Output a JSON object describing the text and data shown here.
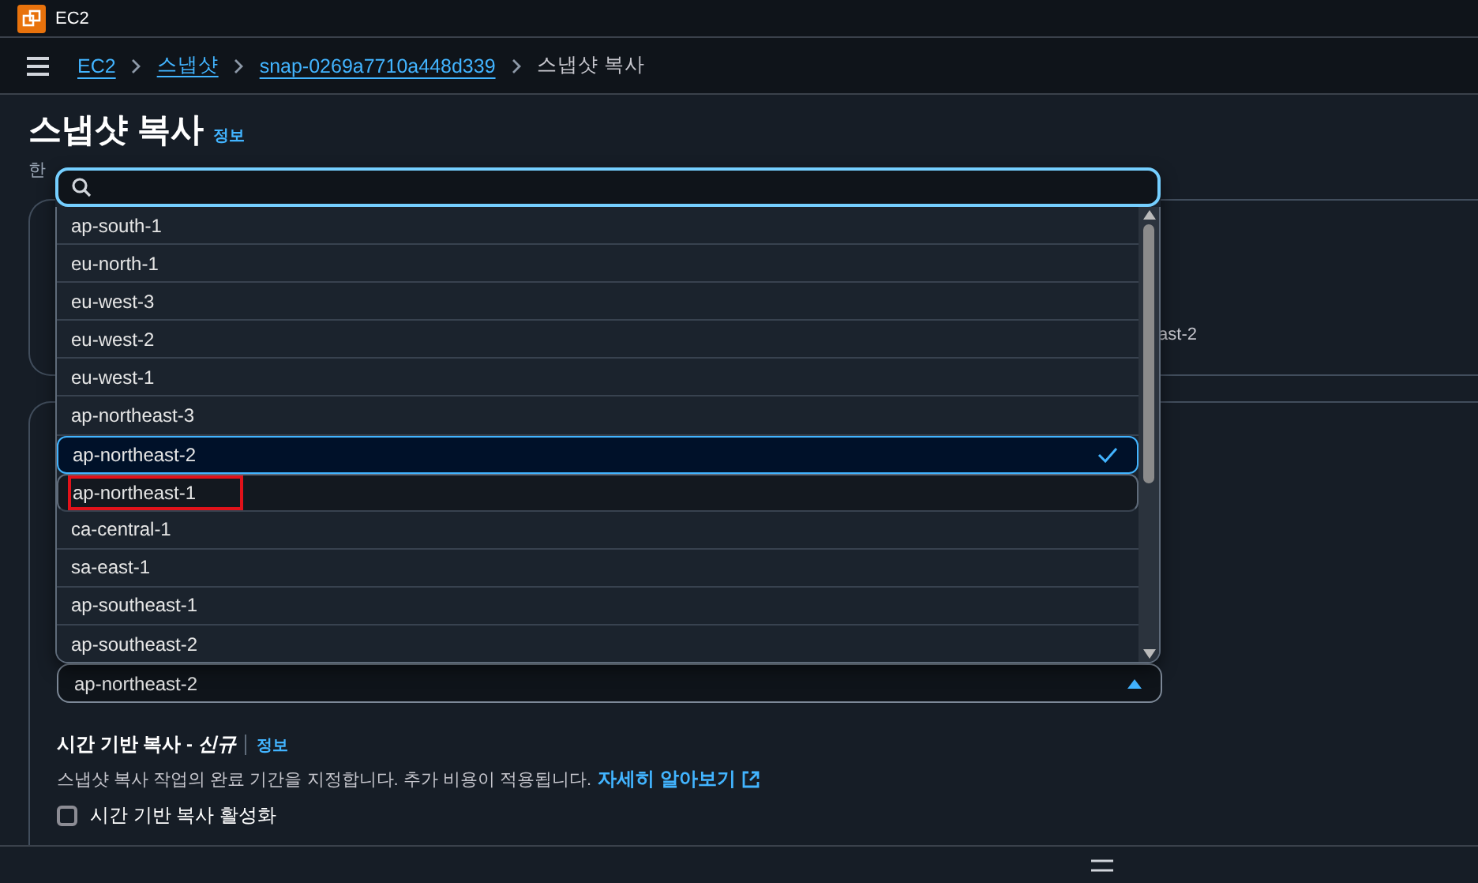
{
  "app": {
    "title": "EC2"
  },
  "breadcrumbs": [
    {
      "label": "EC2",
      "link": true
    },
    {
      "label": "스냅샷",
      "link": true
    },
    {
      "label": "snap-0269a7710a448d339",
      "link": true
    },
    {
      "label": "스냅샷 복사",
      "link": false
    }
  ],
  "page": {
    "title": "스냅샷 복사",
    "info_link": "정보",
    "subtitle": "한"
  },
  "panel_fragment": "ast-2",
  "dropdown": {
    "options": [
      {
        "label": "ap-south-1",
        "selected": false,
        "hovered": false,
        "marked": false
      },
      {
        "label": "eu-north-1",
        "selected": false,
        "hovered": false,
        "marked": false
      },
      {
        "label": "eu-west-3",
        "selected": false,
        "hovered": false,
        "marked": false
      },
      {
        "label": "eu-west-2",
        "selected": false,
        "hovered": false,
        "marked": false
      },
      {
        "label": "eu-west-1",
        "selected": false,
        "hovered": false,
        "marked": false
      },
      {
        "label": "ap-northeast-3",
        "selected": false,
        "hovered": false,
        "marked": false
      },
      {
        "label": "ap-northeast-2",
        "selected": true,
        "hovered": false,
        "marked": false
      },
      {
        "label": "ap-northeast-1",
        "selected": false,
        "hovered": true,
        "marked": true
      },
      {
        "label": "ca-central-1",
        "selected": false,
        "hovered": false,
        "marked": false
      },
      {
        "label": "sa-east-1",
        "selected": false,
        "hovered": false,
        "marked": false
      },
      {
        "label": "ap-southeast-1",
        "selected": false,
        "hovered": false,
        "marked": false
      },
      {
        "label": "ap-southeast-2",
        "selected": false,
        "hovered": false,
        "marked": false
      }
    ]
  },
  "region_select": {
    "value": "ap-northeast-2",
    "expanded": true
  },
  "time_based_copy": {
    "label": "시간 기반 복사 - ",
    "badge": "신규",
    "info_link": "정보",
    "description": "스냅샷 복사 작업의 완료 기간을 지정합니다. 추가 비용이 적용됩니다.",
    "learn_more": "자세히 알아보기",
    "checkbox": {
      "label": "시간 기반 복사 활성화",
      "checked": false
    }
  }
}
